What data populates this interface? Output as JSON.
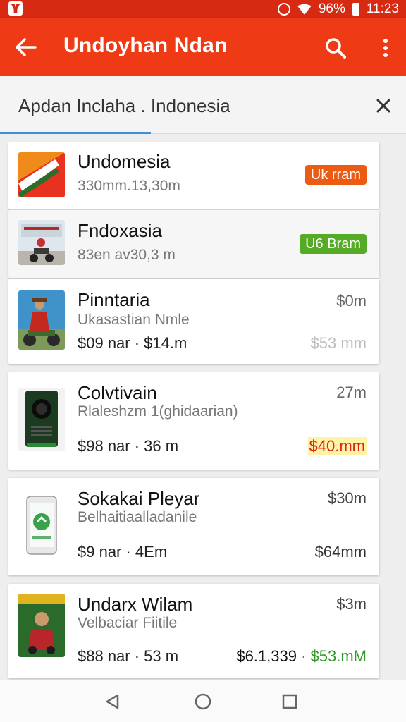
{
  "status_bar": {
    "time": "11:23",
    "battery_text": "96%"
  },
  "app_bar": {
    "title": "Undoyhan Ndan"
  },
  "search": {
    "value": "Apdan Inclaha . Indonesia"
  },
  "items": [
    {
      "title": "Undomesia",
      "subtitle": "330mm.13,30m",
      "badge": "Uk rram",
      "badge_color": "#ec5b14"
    },
    {
      "title": "Fndoxasia",
      "subtitle": "83en av30,3 m",
      "badge": "U6 Bram",
      "badge_color": "#55ab26"
    },
    {
      "title": "Pinntaria",
      "subtitle": "Ukasastian Nmle",
      "price": "$09 nar · $14.m",
      "right_top": "$0m",
      "right_bottom": "$53 mm"
    },
    {
      "title": "Colvtivain",
      "subtitle": "Rlaleshzm 1(ghidaarian)",
      "price": "$98 nar · 36 m",
      "right_top": "27m",
      "right_bottom": "$40.mm"
    },
    {
      "title": "Sokakai Pleyar",
      "subtitle": "Belhaitiaalladanile",
      "price": "$9 nar · 4Em",
      "right_top": "$30m",
      "right_bottom": "$64mm"
    },
    {
      "title": "Undarx Wilam",
      "subtitle": "Velbaciar Fiitile",
      "price": "$88 nar · 53 m",
      "right_top": "$3m",
      "right_bottom_a": "$6.1,339",
      "right_bottom_b": " · $53.mM"
    }
  ],
  "icons": {
    "back": "arrow-left-icon",
    "search": "search-icon",
    "more": "more-vertical-icon",
    "clear": "close-icon",
    "nav_back": "triangle-back-icon",
    "nav_home": "circle-home-icon",
    "nav_recents": "square-recents-icon"
  },
  "colors": {
    "status_bar": "#d62a12",
    "app_bar": "#ef3a16",
    "accent_blue": "#3f8ed8",
    "badge_orange": "#ec5b14",
    "badge_green": "#55ab26",
    "price_red": "#e0250f",
    "price_green": "#2f9a28"
  }
}
